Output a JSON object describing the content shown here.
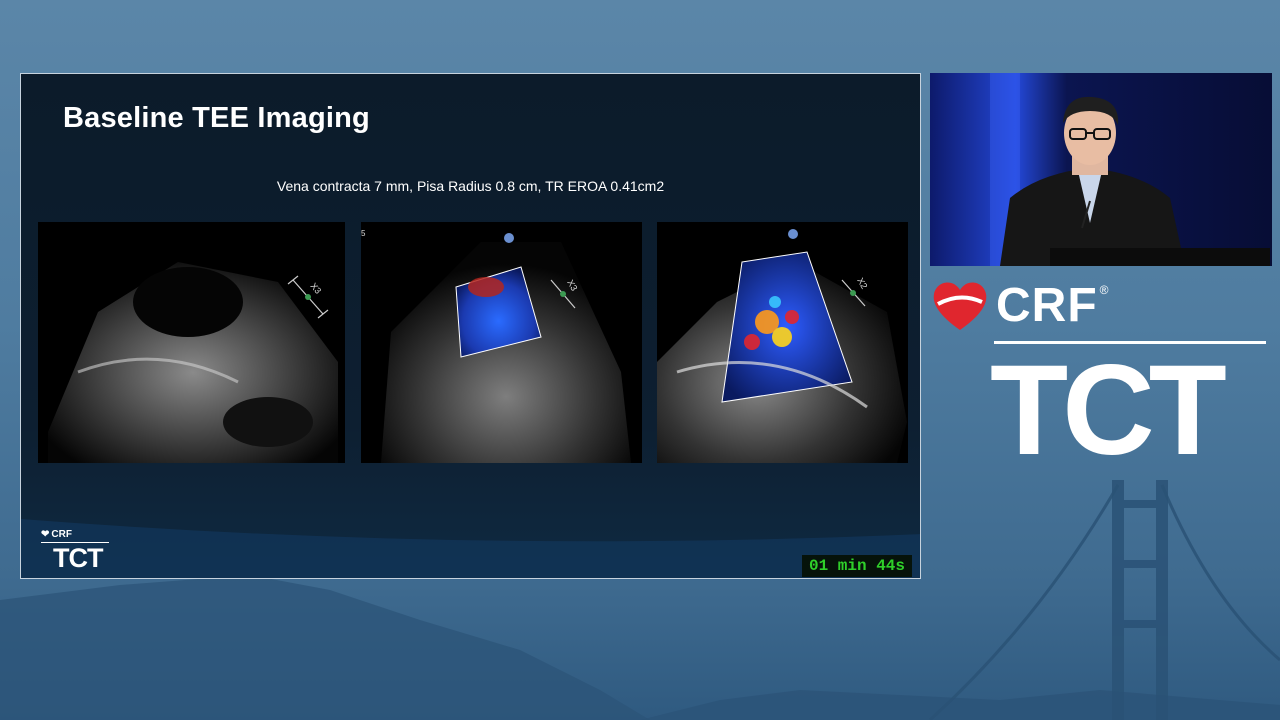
{
  "slide": {
    "title": "Baseline TEE Imaging",
    "subtitle": "Vena contracta 7 mm, Pisa Radius 0.8 cm, TR EROA 0.41cm2",
    "logo_crf": "CRF",
    "logo_tct": "TCT"
  },
  "echo_images": [
    {
      "scale_label": "X3"
    },
    {
      "scale_label": "X3",
      "corner_label": "5"
    },
    {
      "scale_label": "X2"
    }
  ],
  "timer": "01 min 44s",
  "brand": {
    "crf": "CRF",
    "registered": "®",
    "tct": "TCT"
  },
  "colors": {
    "brand_red": "#e0262e",
    "timer_green": "#2fd02a",
    "slide_bg": "#0c1b2a"
  }
}
